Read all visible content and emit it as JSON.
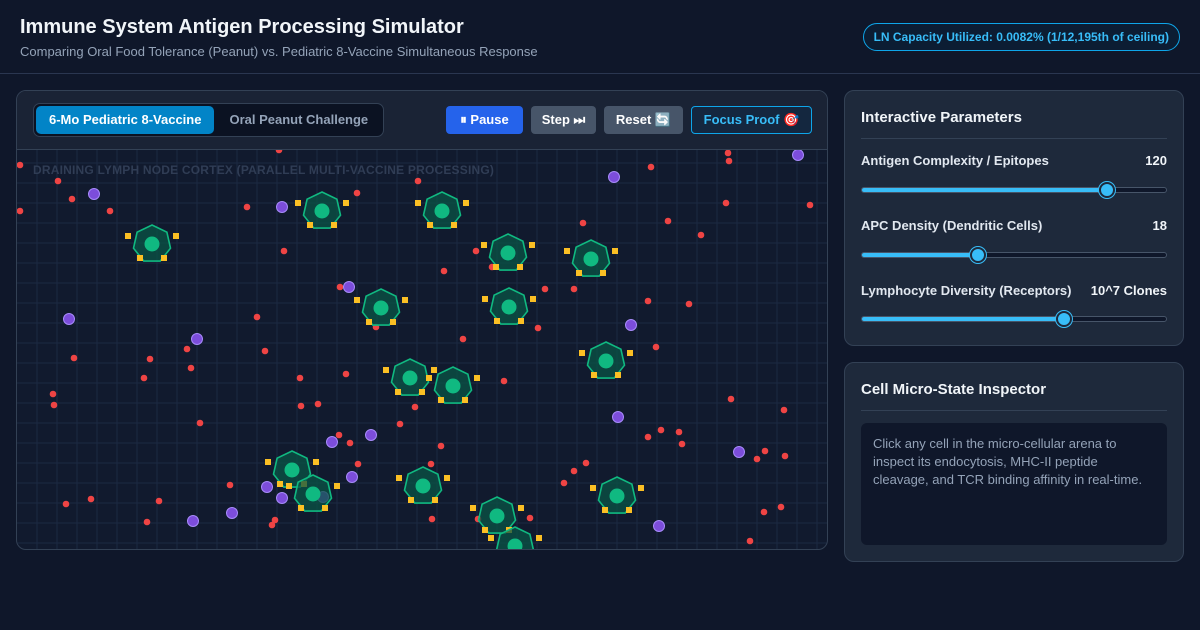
{
  "header": {
    "title": "Immune System Antigen Processing Simulator",
    "subtitle": "Comparing Oral Food Tolerance (Peanut) vs. Pediatric 8-Vaccine Simultaneous Response",
    "capacity_badge": "LN Capacity Utilized: 0.0082% (1/12,195th of ceiling)"
  },
  "toolbar": {
    "tabs": [
      {
        "label": "6-Mo Pediatric 8-Vaccine",
        "active": true
      },
      {
        "label": "Oral Peanut Challenge",
        "active": false
      }
    ],
    "pause_label": "⏸ Pause",
    "step_label": "Step ⏭",
    "reset_label": "Reset 🔄",
    "focus_label": "Focus Proof 🎯"
  },
  "arena": {
    "label": "DRAINING LYMPH NODE CORTEX (PARALLEL MULTI-VACCINE PROCESSING)",
    "colors": {
      "grid": "#1c2942",
      "antigen": "#ef4444",
      "lymphocyte": "#7c4ddb",
      "apc": "#10b981",
      "apc_fill": "#0a5446",
      "receptor": "#fbbf24"
    }
  },
  "parameters": {
    "title": "Interactive Parameters",
    "items": [
      {
        "label": "Antigen Complexity / Epitopes",
        "value": "120",
        "level": 0.8
      },
      {
        "label": "APC Density (Dendritic Cells)",
        "value": "18",
        "level": 0.38
      },
      {
        "label": "Lymphocyte Diversity (Receptors)",
        "value": "10^7 Clones",
        "level": 0.66
      }
    ]
  },
  "inspector": {
    "title": "Cell Micro-State Inspector",
    "text": "Click any cell in the micro-cellular arena to inspect its endocytosis, MHC-II peptide cleavage, and TCR binding affinity in real-time."
  },
  "colors": {
    "accent": "#0284c7",
    "pause": "#2563eb",
    "focus": "#38bdf8"
  }
}
